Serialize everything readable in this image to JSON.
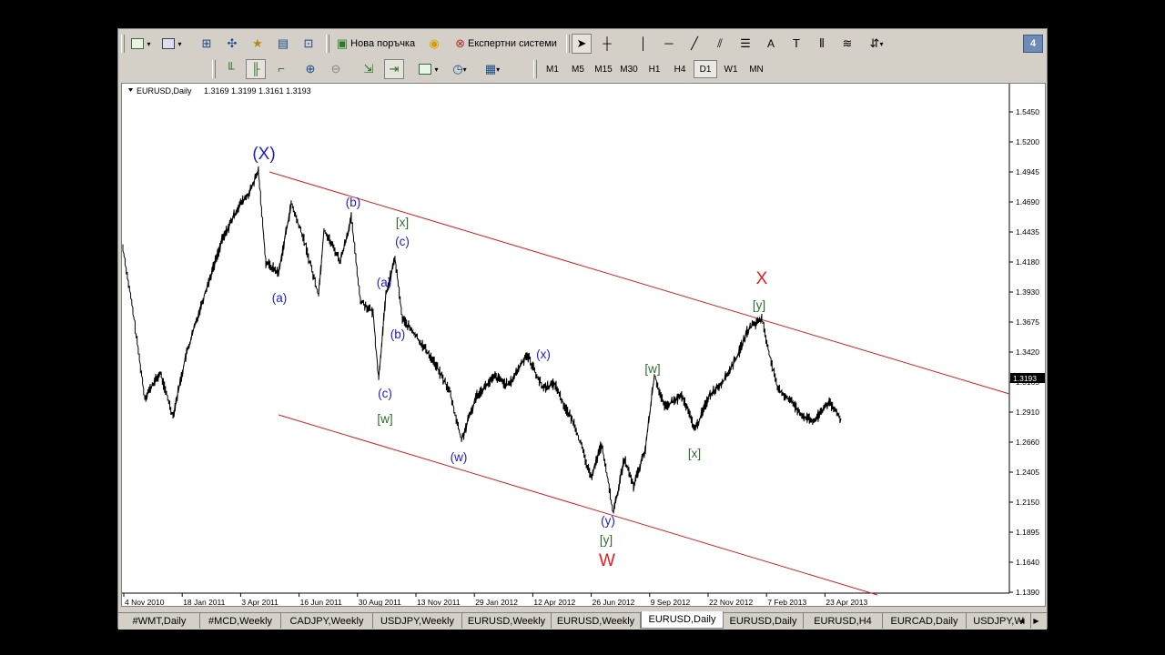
{
  "toolbar1": {
    "new_order_label": "Нова поръчка",
    "expert_systems_label": "Експертни системи",
    "text_tool_label": "A",
    "window_count_badge": "4"
  },
  "toolbar2": {
    "timeframes": [
      "M1",
      "M5",
      "M15",
      "M30",
      "H1",
      "H4",
      "D1",
      "W1",
      "MN"
    ],
    "active_timeframe": "D1"
  },
  "chart": {
    "header": "EURUSD,Daily",
    "ohlc": "1.3169 1.3199 1.3161 1.3193",
    "current_price_label": "1.3193",
    "price_ticks": [
      "1.5450",
      "1.5200",
      "1.4945",
      "1.4690",
      "1.4435",
      "1.4180",
      "1.3930",
      "1.3675",
      "1.3420",
      "1.3165",
      "1.2910",
      "1.2660",
      "1.2405",
      "1.2150",
      "1.1895",
      "1.1640",
      "1.1390"
    ],
    "date_ticks": [
      "4 Nov 2010",
      "18 Jan 2011",
      "3 Apr 2011",
      "16 Jun 2011",
      "30 Aug 2011",
      "13 Nov 2011",
      "29 Jan 2012",
      "12 Apr 2012",
      "26 Jun 2012",
      "9 Sep 2012",
      "22 Nov 2012",
      "7 Feb 2013",
      "23 Apr 2013"
    ],
    "wave_labels": [
      {
        "text": "(X)",
        "color": "#1c1cc8",
        "size": "big"
      },
      {
        "text": "(a)",
        "color": "#1c1cc8",
        "size": "normal"
      },
      {
        "text": "(b)",
        "color": "#1c1cc8",
        "size": "normal"
      },
      {
        "text": "[x]",
        "color": "#2e6b2e",
        "size": "normal"
      },
      {
        "text": "(c)",
        "color": "#1c1cc8",
        "size": "normal"
      },
      {
        "text": "(a)",
        "color": "#1c1cc8",
        "size": "normal"
      },
      {
        "text": "(b)",
        "color": "#1c1cc8",
        "size": "normal"
      },
      {
        "text": "(c)",
        "color": "#1c1cc8",
        "size": "normal"
      },
      {
        "text": "[w]",
        "color": "#2e6b2e",
        "size": "normal"
      },
      {
        "text": "(w)",
        "color": "#1c1cc8",
        "size": "normal"
      },
      {
        "text": "(x)",
        "color": "#1c1cc8",
        "size": "normal"
      },
      {
        "text": "(y)",
        "color": "#1c1cc8",
        "size": "normal"
      },
      {
        "text": "[y]",
        "color": "#2e6b2e",
        "size": "normal"
      },
      {
        "text": "W",
        "color": "#e02020",
        "size": "big"
      },
      {
        "text": "[w]",
        "color": "#2e6b2e",
        "size": "normal"
      },
      {
        "text": "[x]",
        "color": "#2e6b2e",
        "size": "normal"
      },
      {
        "text": "[y]",
        "color": "#2e6b2e",
        "size": "normal"
      },
      {
        "text": "X",
        "color": "#e02020",
        "size": "big"
      }
    ],
    "channel_color": "#d02020",
    "price_line_color": "#000000"
  },
  "tabs": [
    {
      "label": "#WMT,Daily",
      "active": false
    },
    {
      "label": "#MCD,Weekly",
      "active": false
    },
    {
      "label": "CADJPY,Weekly",
      "active": false
    },
    {
      "label": "USDJPY,Weekly",
      "active": false
    },
    {
      "label": "EURUSD,Weekly",
      "active": false
    },
    {
      "label": "EURUSD,Weekly",
      "active": false
    },
    {
      "label": "EURUSD,Daily",
      "active": true
    },
    {
      "label": "EURUSD,Daily",
      "active": false
    },
    {
      "label": "EURUSD,H4",
      "active": false
    },
    {
      "label": "EURCAD,Daily",
      "active": false
    },
    {
      "label": "USDJPY,W",
      "active": false
    }
  ]
}
